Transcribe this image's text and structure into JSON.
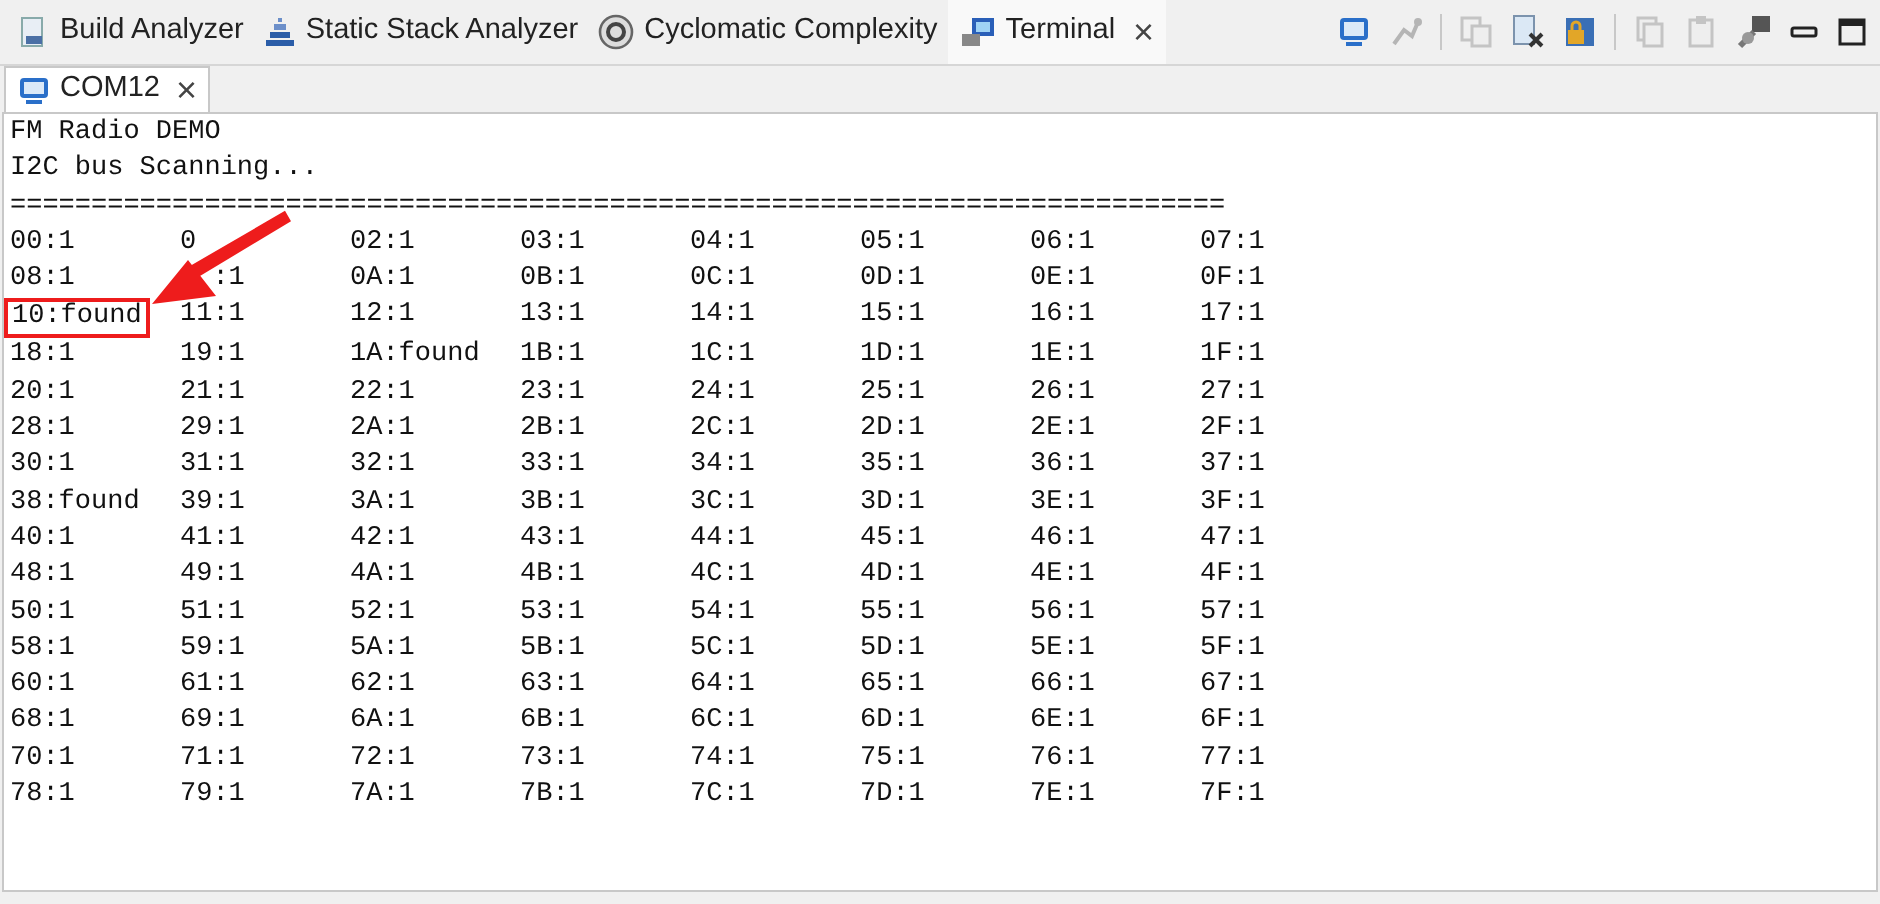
{
  "view_tabs": [
    {
      "label": "Build Analyzer",
      "selected": false,
      "closable": false,
      "kind": "build"
    },
    {
      "label": "Static Stack Analyzer",
      "selected": false,
      "closable": false,
      "kind": "stack"
    },
    {
      "label": "Cyclomatic Complexity",
      "selected": false,
      "closable": false,
      "kind": "cyclo"
    },
    {
      "label": "Terminal",
      "selected": true,
      "closable": true,
      "kind": "terminal"
    }
  ],
  "session_tab": {
    "label": "COM12",
    "selected": true,
    "close": "×"
  },
  "close_glyph": "×",
  "terminal": {
    "lines": [
      "FM Radio DEMO",
      "I2C bus Scanning...",
      "==========================================================================="
    ],
    "scan_rows": [
      [
        {
          "text": "00:1",
          "highlighted": false
        },
        {
          "kind": "partly_covered",
          "lead": "0",
          "highlighted": false
        },
        {
          "text": "02:1",
          "highlighted": false
        },
        {
          "text": "03:1",
          "highlighted": false
        },
        {
          "text": "04:1",
          "highlighted": false
        },
        {
          "text": "05:1",
          "highlighted": false
        },
        {
          "text": "06:1",
          "highlighted": false
        },
        {
          "text": "07:1",
          "highlighted": false
        }
      ],
      [
        {
          "text": "08:1",
          "highlighted": false
        },
        {
          "kind": "partly_covered",
          "tail": ":1",
          "highlighted": false
        },
        {
          "text": "0A:1",
          "highlighted": false
        },
        {
          "text": "0B:1",
          "highlighted": false
        },
        {
          "text": "0C:1",
          "highlighted": false
        },
        {
          "text": "0D:1",
          "highlighted": false
        },
        {
          "text": "0E:1",
          "highlighted": false
        },
        {
          "text": "0F:1",
          "highlighted": false
        }
      ],
      [
        {
          "text": "10:found",
          "highlighted": true
        },
        {
          "text": "11:1",
          "highlighted": false
        },
        {
          "text": "12:1",
          "highlighted": false
        },
        {
          "text": "13:1",
          "highlighted": false
        },
        {
          "text": "14:1",
          "highlighted": false
        },
        {
          "text": "15:1",
          "highlighted": false
        },
        {
          "text": "16:1",
          "highlighted": false
        },
        {
          "text": "17:1",
          "highlighted": false
        }
      ],
      [
        {
          "text": "18:1",
          "highlighted": false
        },
        {
          "text": "19:1",
          "highlighted": false
        },
        {
          "text": "1A:found",
          "highlighted": false
        },
        {
          "text": "1B:1",
          "highlighted": false
        },
        {
          "text": "1C:1",
          "highlighted": false
        },
        {
          "text": "1D:1",
          "highlighted": false
        },
        {
          "text": "1E:1",
          "highlighted": false
        },
        {
          "text": "1F:1",
          "highlighted": false
        }
      ],
      [
        {
          "text": "20:1",
          "highlighted": false
        },
        {
          "text": "21:1",
          "highlighted": false
        },
        {
          "text": "22:1",
          "highlighted": false
        },
        {
          "text": "23:1",
          "highlighted": false
        },
        {
          "text": "24:1",
          "highlighted": false
        },
        {
          "text": "25:1",
          "highlighted": false
        },
        {
          "text": "26:1",
          "highlighted": false
        },
        {
          "text": "27:1",
          "highlighted": false
        }
      ],
      [
        {
          "text": "28:1",
          "highlighted": false
        },
        {
          "text": "29:1",
          "highlighted": false
        },
        {
          "text": "2A:1",
          "highlighted": false
        },
        {
          "text": "2B:1",
          "highlighted": false
        },
        {
          "text": "2C:1",
          "highlighted": false
        },
        {
          "text": "2D:1",
          "highlighted": false
        },
        {
          "text": "2E:1",
          "highlighted": false
        },
        {
          "text": "2F:1",
          "highlighted": false
        }
      ],
      [
        {
          "text": "30:1",
          "highlighted": false
        },
        {
          "text": "31:1",
          "highlighted": false
        },
        {
          "text": "32:1",
          "highlighted": false
        },
        {
          "text": "33:1",
          "highlighted": false
        },
        {
          "text": "34:1",
          "highlighted": false
        },
        {
          "text": "35:1",
          "highlighted": false
        },
        {
          "text": "36:1",
          "highlighted": false
        },
        {
          "text": "37:1",
          "highlighted": false
        }
      ],
      [
        {
          "text": "38:found",
          "highlighted": false
        },
        {
          "text": "39:1",
          "highlighted": false
        },
        {
          "text": "3A:1",
          "highlighted": false
        },
        {
          "text": "3B:1",
          "highlighted": false
        },
        {
          "text": "3C:1",
          "highlighted": false
        },
        {
          "text": "3D:1",
          "highlighted": false
        },
        {
          "text": "3E:1",
          "highlighted": false
        },
        {
          "text": "3F:1",
          "highlighted": false
        }
      ],
      [
        {
          "text": "40:1",
          "highlighted": false
        },
        {
          "text": "41:1",
          "highlighted": false
        },
        {
          "text": "42:1",
          "highlighted": false
        },
        {
          "text": "43:1",
          "highlighted": false
        },
        {
          "text": "44:1",
          "highlighted": false
        },
        {
          "text": "45:1",
          "highlighted": false
        },
        {
          "text": "46:1",
          "highlighted": false
        },
        {
          "text": "47:1",
          "highlighted": false
        }
      ],
      [
        {
          "text": "48:1",
          "highlighted": false
        },
        {
          "text": "49:1",
          "highlighted": false
        },
        {
          "text": "4A:1",
          "highlighted": false
        },
        {
          "text": "4B:1",
          "highlighted": false
        },
        {
          "text": "4C:1",
          "highlighted": false
        },
        {
          "text": "4D:1",
          "highlighted": false
        },
        {
          "text": "4E:1",
          "highlighted": false
        },
        {
          "text": "4F:1",
          "highlighted": false
        }
      ],
      [
        {
          "text": "50:1",
          "highlighted": false
        },
        {
          "text": "51:1",
          "highlighted": false
        },
        {
          "text": "52:1",
          "highlighted": false
        },
        {
          "text": "53:1",
          "highlighted": false
        },
        {
          "text": "54:1",
          "highlighted": false
        },
        {
          "text": "55:1",
          "highlighted": false
        },
        {
          "text": "56:1",
          "highlighted": false
        },
        {
          "text": "57:1",
          "highlighted": false
        }
      ],
      [
        {
          "text": "58:1",
          "highlighted": false
        },
        {
          "text": "59:1",
          "highlighted": false
        },
        {
          "text": "5A:1",
          "highlighted": false
        },
        {
          "text": "5B:1",
          "highlighted": false
        },
        {
          "text": "5C:1",
          "highlighted": false
        },
        {
          "text": "5D:1",
          "highlighted": false
        },
        {
          "text": "5E:1",
          "highlighted": false
        },
        {
          "text": "5F:1",
          "highlighted": false
        }
      ],
      [
        {
          "text": "60:1",
          "highlighted": false
        },
        {
          "text": "61:1",
          "highlighted": false
        },
        {
          "text": "62:1",
          "highlighted": false
        },
        {
          "text": "63:1",
          "highlighted": false
        },
        {
          "text": "64:1",
          "highlighted": false
        },
        {
          "text": "65:1",
          "highlighted": false
        },
        {
          "text": "66:1",
          "highlighted": false
        },
        {
          "text": "67:1",
          "highlighted": false
        }
      ],
      [
        {
          "text": "68:1",
          "highlighted": false
        },
        {
          "text": "69:1",
          "highlighted": false
        },
        {
          "text": "6A:1",
          "highlighted": false
        },
        {
          "text": "6B:1",
          "highlighted": false
        },
        {
          "text": "6C:1",
          "highlighted": false
        },
        {
          "text": "6D:1",
          "highlighted": false
        },
        {
          "text": "6E:1",
          "highlighted": false
        },
        {
          "text": "6F:1",
          "highlighted": false
        }
      ],
      [
        {
          "text": "70:1",
          "highlighted": false
        },
        {
          "text": "71:1",
          "highlighted": false
        },
        {
          "text": "72:1",
          "highlighted": false
        },
        {
          "text": "73:1",
          "highlighted": false
        },
        {
          "text": "74:1",
          "highlighted": false
        },
        {
          "text": "75:1",
          "highlighted": false
        },
        {
          "text": "76:1",
          "highlighted": false
        },
        {
          "text": "77:1",
          "highlighted": false
        }
      ],
      [
        {
          "text": "78:1",
          "highlighted": false
        },
        {
          "text": "79:1",
          "highlighted": false
        },
        {
          "text": "7A:1",
          "highlighted": false
        },
        {
          "text": "7B:1",
          "highlighted": false
        },
        {
          "text": "7C:1",
          "highlighted": false
        },
        {
          "text": "7D:1",
          "highlighted": false
        },
        {
          "text": "7E:1",
          "highlighted": false
        },
        {
          "text": "7F:1",
          "highlighted": false
        }
      ]
    ]
  }
}
